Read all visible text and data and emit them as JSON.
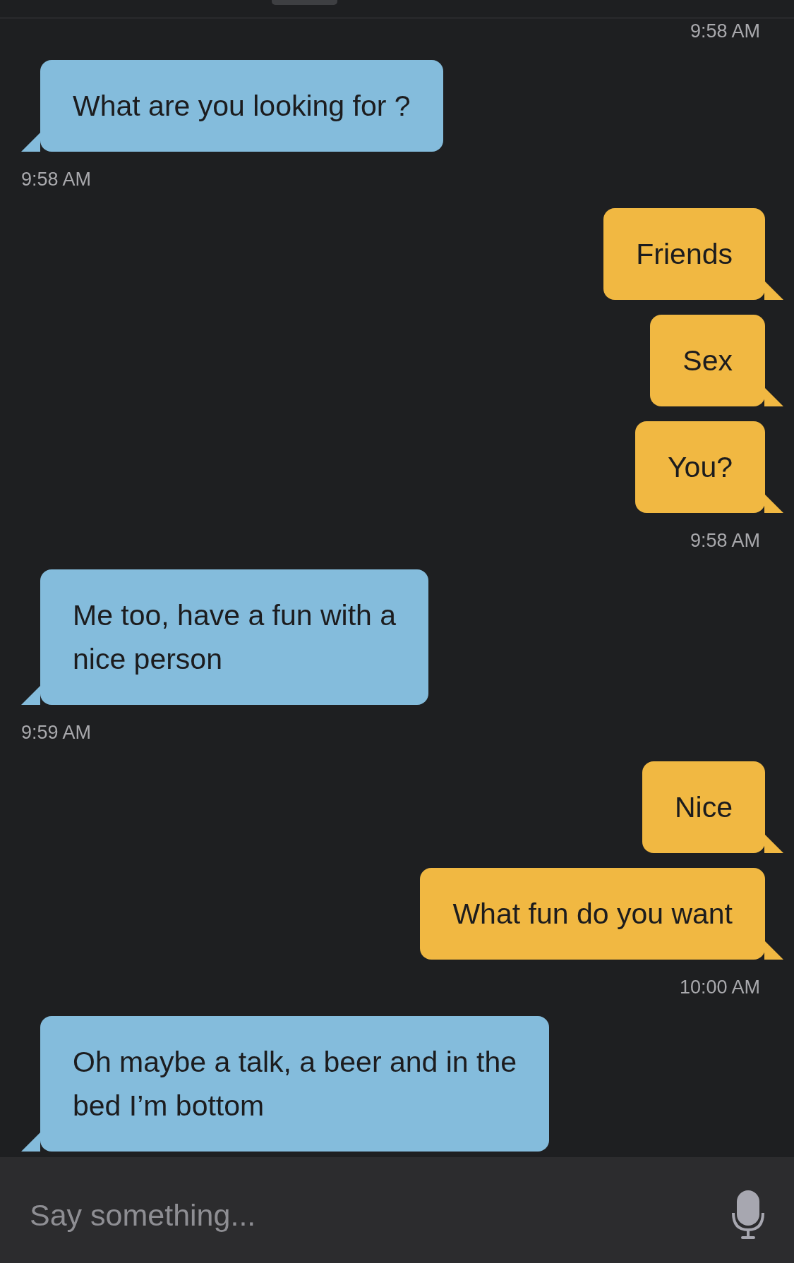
{
  "messages": [
    {
      "kind": "sent_time",
      "text": "9:58 AM"
    },
    {
      "kind": "bubble",
      "outgoing": false,
      "text": "What are you looking for ?"
    },
    {
      "kind": "received_time",
      "text": "9:58 AM"
    },
    {
      "kind": "bubble",
      "outgoing": true,
      "text": "Friends"
    },
    {
      "kind": "bubble",
      "outgoing": true,
      "text": "Sex"
    },
    {
      "kind": "bubble",
      "outgoing": true,
      "text": "You?"
    },
    {
      "kind": "sent_time",
      "text": "9:58 AM"
    },
    {
      "kind": "bubble",
      "outgoing": false,
      "text": "Me too, have a fun with a\nnice person"
    },
    {
      "kind": "received_time",
      "text": "9:59 AM"
    },
    {
      "kind": "bubble",
      "outgoing": true,
      "text": "Nice"
    },
    {
      "kind": "bubble",
      "outgoing": true,
      "text": "What fun do you want"
    },
    {
      "kind": "sent_time",
      "text": "10:00 AM"
    },
    {
      "kind": "bubble",
      "outgoing": false,
      "text": "Oh maybe a talk, a beer and in the\nbed I’m bottom"
    }
  ],
  "composer": {
    "placeholder": "Say something..."
  }
}
